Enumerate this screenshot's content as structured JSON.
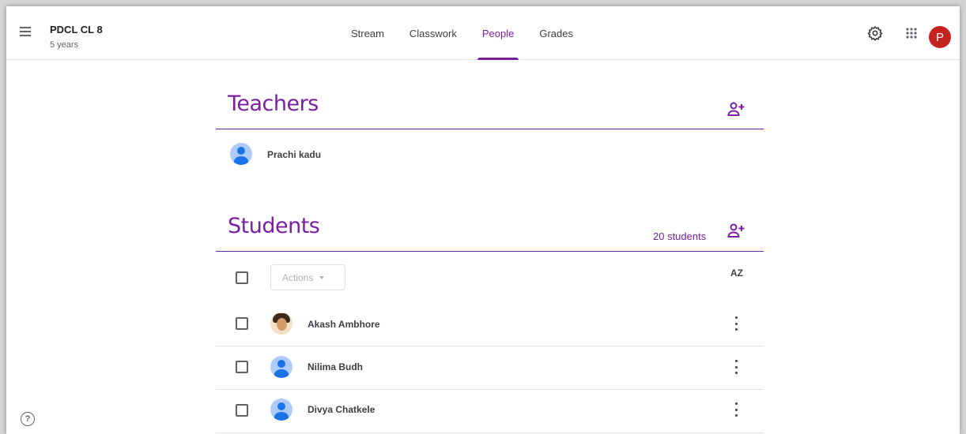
{
  "header": {
    "class_name": "PDCL CL 8",
    "class_subtitle": "5 years",
    "tabs": [
      {
        "label": "Stream",
        "active": false
      },
      {
        "label": "Classwork",
        "active": false
      },
      {
        "label": "People",
        "active": true
      },
      {
        "label": "Grades",
        "active": false
      }
    ],
    "settings_icon": "gear-icon",
    "apps_icon": "apps-grid-icon",
    "account_initial": "P",
    "account_color": "#c5221f"
  },
  "accent_color": "#7b1fa2",
  "teachers": {
    "title": "Teachers",
    "add_icon": "add-person-icon",
    "list": [
      {
        "name": "Prachi kadu",
        "avatar": "default-avatar"
      }
    ]
  },
  "students": {
    "title": "Students",
    "count_label": "20 students",
    "add_icon": "add-person-icon",
    "actions_label": "Actions",
    "sort_label": "AZ",
    "list": [
      {
        "name": "Akash Ambhore",
        "avatar": "photo-avatar"
      },
      {
        "name": "Nilima Budh",
        "avatar": "default-avatar"
      },
      {
        "name": "Divya Chatkele",
        "avatar": "default-avatar"
      }
    ]
  },
  "help_icon": "help-icon",
  "help_glyph": "?"
}
